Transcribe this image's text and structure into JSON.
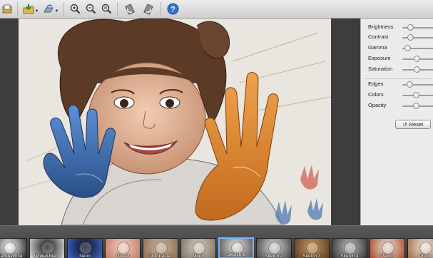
{
  "toolbar": {
    "buttons": [
      {
        "name": "open-image-icon"
      },
      {
        "name": "save-image-icon"
      },
      {
        "name": "share-icon"
      },
      {
        "name": "zoom-in-icon"
      },
      {
        "name": "zoom-out-icon"
      },
      {
        "name": "zoom-fit-icon"
      },
      {
        "name": "rotate-left-icon"
      },
      {
        "name": "rotate-right-icon"
      },
      {
        "name": "help-icon"
      }
    ]
  },
  "adjustments": {
    "sliders": [
      {
        "label": "Brightness",
        "value": 0.28
      },
      {
        "label": "Contrast",
        "value": 0.28
      },
      {
        "label": "Gamma",
        "value": 0.18
      },
      {
        "label": "Exposure",
        "value": 0.48
      },
      {
        "label": "Saturation",
        "value": 0.48
      },
      {
        "label": "Edges",
        "value": 0.25
      },
      {
        "label": "Colors",
        "value": 0.45
      },
      {
        "label": "Opacity",
        "value": 0.45
      }
    ],
    "reset_label": "Reset"
  },
  "filters": {
    "items": [
      {
        "label": "Black&White",
        "selected": false
      },
      {
        "label": "White&Black",
        "selected": false
      },
      {
        "label": "Neon",
        "selected": false
      },
      {
        "label": "Pastel",
        "selected": false
      },
      {
        "label": "Dull Pastel",
        "selected": false
      },
      {
        "label": "Mono",
        "selected": false
      },
      {
        "label": "Sketch 1",
        "selected": true
      },
      {
        "label": "Sketch 2",
        "selected": false
      },
      {
        "label": "Sketch 3",
        "selected": false
      },
      {
        "label": "Sketch 4",
        "selected": false
      },
      {
        "label": "Pencil",
        "selected": false
      },
      {
        "label": "Photo",
        "selected": false
      }
    ]
  },
  "colors": {
    "accent": "#6fb5ff",
    "toolbar_bg": "#dcdcdc",
    "canvas_bg": "#3d3d3d"
  }
}
